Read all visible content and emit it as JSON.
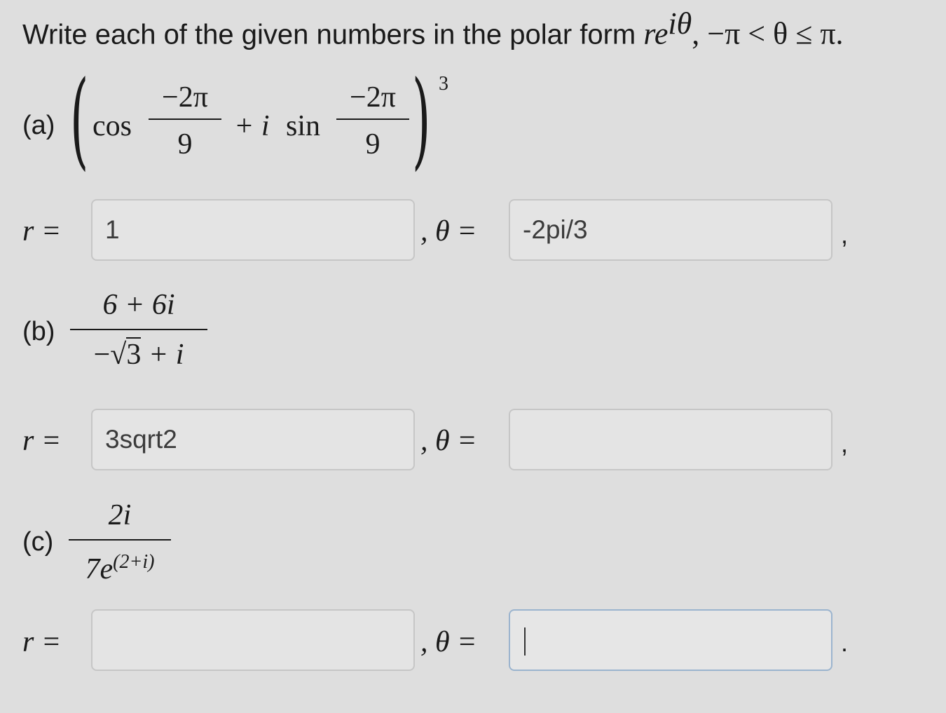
{
  "prompt": {
    "text": "Write each of the given numbers in the polar form ",
    "form_r": "re",
    "form_exp": "iθ",
    "range_text": ", −π < θ ≤ π."
  },
  "parts": [
    {
      "label": "(a)",
      "expr": {
        "cos": "cos",
        "sin": "sin",
        "plus_i": "+ i",
        "num": "−2π",
        "den": "9",
        "power": "3"
      },
      "r_label": "r =",
      "theta_label": ", θ =",
      "r_value": "1",
      "theta_value": "-2pi/3",
      "end_punct": ","
    },
    {
      "label": "(b)",
      "expr": {
        "num": "6 + 6i",
        "den_minus": "−",
        "den_root": "3",
        "den_tail": "+ i"
      },
      "r_label": "r =",
      "theta_label": ", θ =",
      "r_value": "3sqrt2",
      "theta_value": "",
      "end_punct": ","
    },
    {
      "label": "(c)",
      "expr": {
        "num": "2i",
        "den_base": "7e",
        "den_exp": "(2+i)"
      },
      "r_label": "r =",
      "theta_label": ", θ =",
      "r_value": "",
      "theta_value": "",
      "end_punct": "."
    }
  ]
}
